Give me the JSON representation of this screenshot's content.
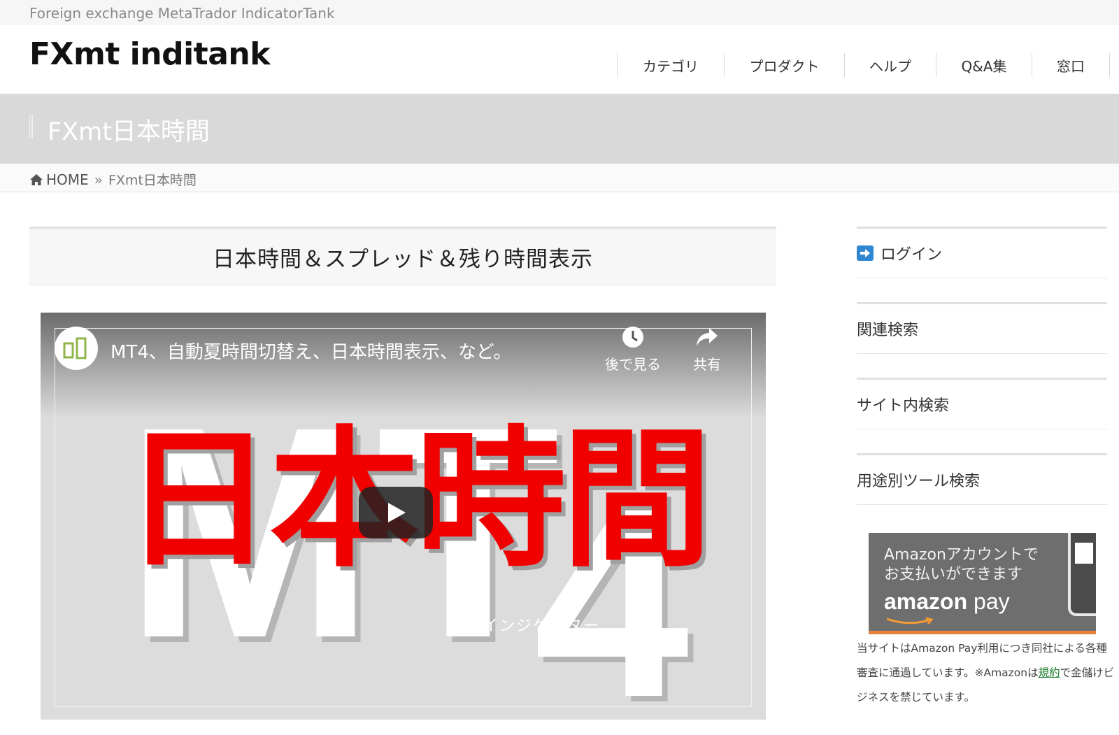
{
  "site": {
    "tagline": "Foreign exchange MetaTrador IndicatorTank",
    "logo": "FXmt inditank"
  },
  "nav": {
    "items": [
      {
        "label": "カテゴリ",
        "width": 152
      },
      {
        "label": "プロダクト",
        "width": 171
      },
      {
        "label": "ヘルプ",
        "width": 130
      },
      {
        "label": "Q&A集",
        "width": 136
      },
      {
        "label": "窓口",
        "width": 110
      }
    ]
  },
  "banner": {
    "title": "FXmt日本時間"
  },
  "breadcrumb": {
    "home": "HOME",
    "separator": "»",
    "current": "FXmt日本時間"
  },
  "post": {
    "title": "日本時間＆スプレッド＆残り時間表示"
  },
  "video": {
    "title": "MT4、自動夏時間切替え、日本時間表示、など。",
    "watch_later": "後で見る",
    "share": "共有",
    "thumb_text_m": "M",
    "thumb_text_t": "T",
    "thumb_text_4": "4",
    "thumb_text_jp": "日本時間",
    "thumb_subtitle": "インジケーター"
  },
  "sidebar": {
    "login": "ログイン",
    "related_search": "関連検索",
    "site_search": "サイト内検索",
    "tool_search": "用途別ツール検索"
  },
  "ad": {
    "line1": "Amazonアカウントで",
    "line2": "お支払いができます",
    "logo_bold": "amazon",
    "logo_light": " pay"
  },
  "amazon_note": {
    "part1": "当サイトはAmazon Pay利用につき同社による各種審査に通過しています。※Amazonは",
    "link": "規約",
    "part2": "で金儲けビジネスを禁じています。"
  },
  "colors": {
    "accent_red": "#f10000",
    "banner_gray": "#d9d9d9",
    "login_blue": "#2f86d1",
    "amazon_orange": "#e8823a",
    "link_green": "#1a7a2a"
  }
}
